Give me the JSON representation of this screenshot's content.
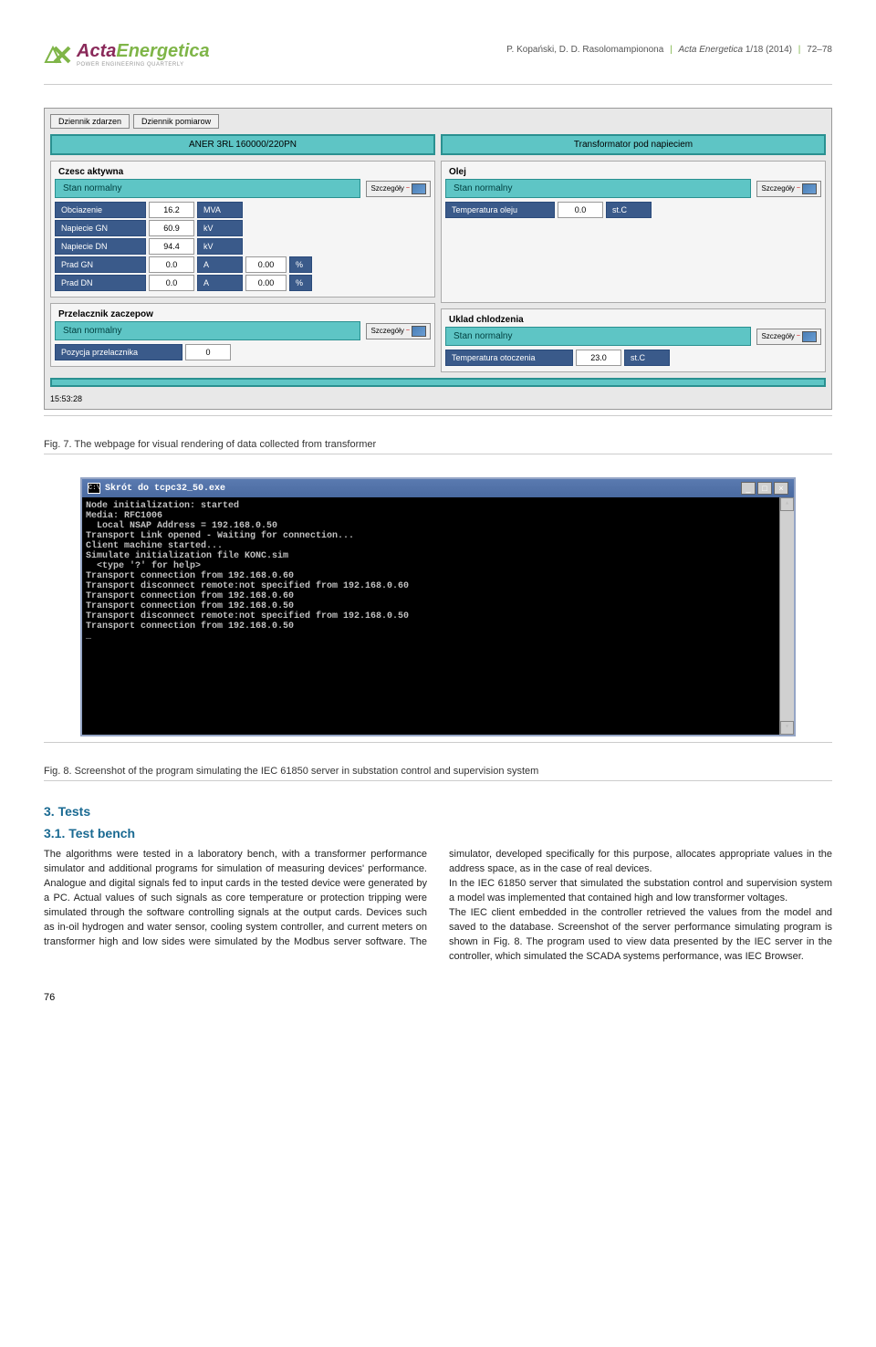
{
  "header": {
    "logo": {
      "text1": "Acta",
      "text2": "Energetica",
      "sub": "POWER ENGINEERING QUARTERLY"
    },
    "citation": {
      "authors": "P. Kopański, D. D. Rasolomampionona",
      "journal": "Acta Energetica",
      "issue": "1/18 (2014)",
      "pages": "72–78"
    }
  },
  "fig7": {
    "tabs": [
      "Dziennik zdarzen",
      "Dziennik pomiarow"
    ],
    "top_left_bar": "ANER 3RL 160000/220PN",
    "top_right_bar": "Transformator pod napieciem",
    "czesc_aktywna": {
      "title": "Czesc aktywna",
      "status": "Stan normalny",
      "btn": "Szczegóły"
    },
    "olej": {
      "title": "Olej",
      "status": "Stan normalny",
      "btn": "Szczegóły",
      "temp": {
        "label": "Temperatura oleju",
        "val": "0.0",
        "unit": "st.C"
      }
    },
    "rows_left": [
      {
        "label": "Obciazenie",
        "v1": "16.2",
        "u1": "MVA"
      },
      {
        "label": "Napiecie GN",
        "v1": "60.9",
        "u1": "kV"
      },
      {
        "label": "Napiecie DN",
        "v1": "94.4",
        "u1": "kV"
      },
      {
        "label": "Prad GN",
        "v1": "0.0",
        "u1": "A",
        "v2": "0.00",
        "u2": "%"
      },
      {
        "label": "Prad DN",
        "v1": "0.0",
        "u1": "A",
        "v2": "0.00",
        "u2": "%"
      }
    ],
    "przelacznik": {
      "title": "Przelacznik zaczepow",
      "status": "Stan normalny",
      "btn": "Szczegóły",
      "poz": {
        "label": "Pozycja przelacznika",
        "val": "0"
      }
    },
    "uklad": {
      "title": "Uklad chlodzenia",
      "status": "Stan normalny",
      "btn": "Szczegóły",
      "temp": {
        "label": "Temperatura otoczenia",
        "val": "23.0",
        "unit": "st.C"
      }
    },
    "timestamp": "15:53:28",
    "caption": "Fig. 7. The webpage for visual rendering of data collected from transformer"
  },
  "fig8": {
    "title_icon": "C:\\",
    "title": "Skrót do tcpc32_50.exe",
    "lines": [
      "Node initialization: started",
      "Media: RFC1006",
      "  Local NSAP Address = 192.168.0.50",
      "Transport Link opened - Waiting for connection...",
      "Client machine started...",
      "Simulate initialization file KONC.sim",
      "  <type '?' for help>",
      "Transport connection from 192.168.0.60",
      "Transport disconnect remote:not specified from 192.168.0.60",
      "Transport connection from 192.168.0.60",
      "Transport connection from 192.168.0.50",
      "Transport disconnect remote:not specified from 192.168.0.50",
      "Transport connection from 192.168.0.50",
      "_"
    ],
    "caption": "Fig. 8. Screenshot of the program simulating the IEC 61850 server in substation control and supervision system"
  },
  "body": {
    "section_head": "3. Tests",
    "subhead": "3.1. Test bench",
    "p1": "The algorithms were tested in a laboratory bench, with a transformer performance simulator and additional programs for simulation of measuring devices' performance. Analogue and digital signals fed to input cards in the tested device were generated by a PC. Actual values of such signals as core temperature or protection tripping were simulated through the software controlling signals at the output cards. Devices such as in-oil hydrogen and water sensor, cooling system controller, and current meters on transformer high and low sides were simulated by the Modbus ",
    "p2": "server software. The simulator, developed specifically for this purpose, allocates appropriate values in the address space, as in the case of real devices.",
    "p3": "In the IEC 61850 server that simulated the substation control and supervision system a model was implemented that contained high and low transformer voltages.",
    "p4": "The IEC client embedded in the controller retrieved the values from the model and saved to the database. Screenshot of the server performance simulating program is shown in Fig. 8. The program used to view data presented by the IEC server in the controller, which simulated the SCADA systems performance, was IEC Browser."
  },
  "page_number": "76"
}
